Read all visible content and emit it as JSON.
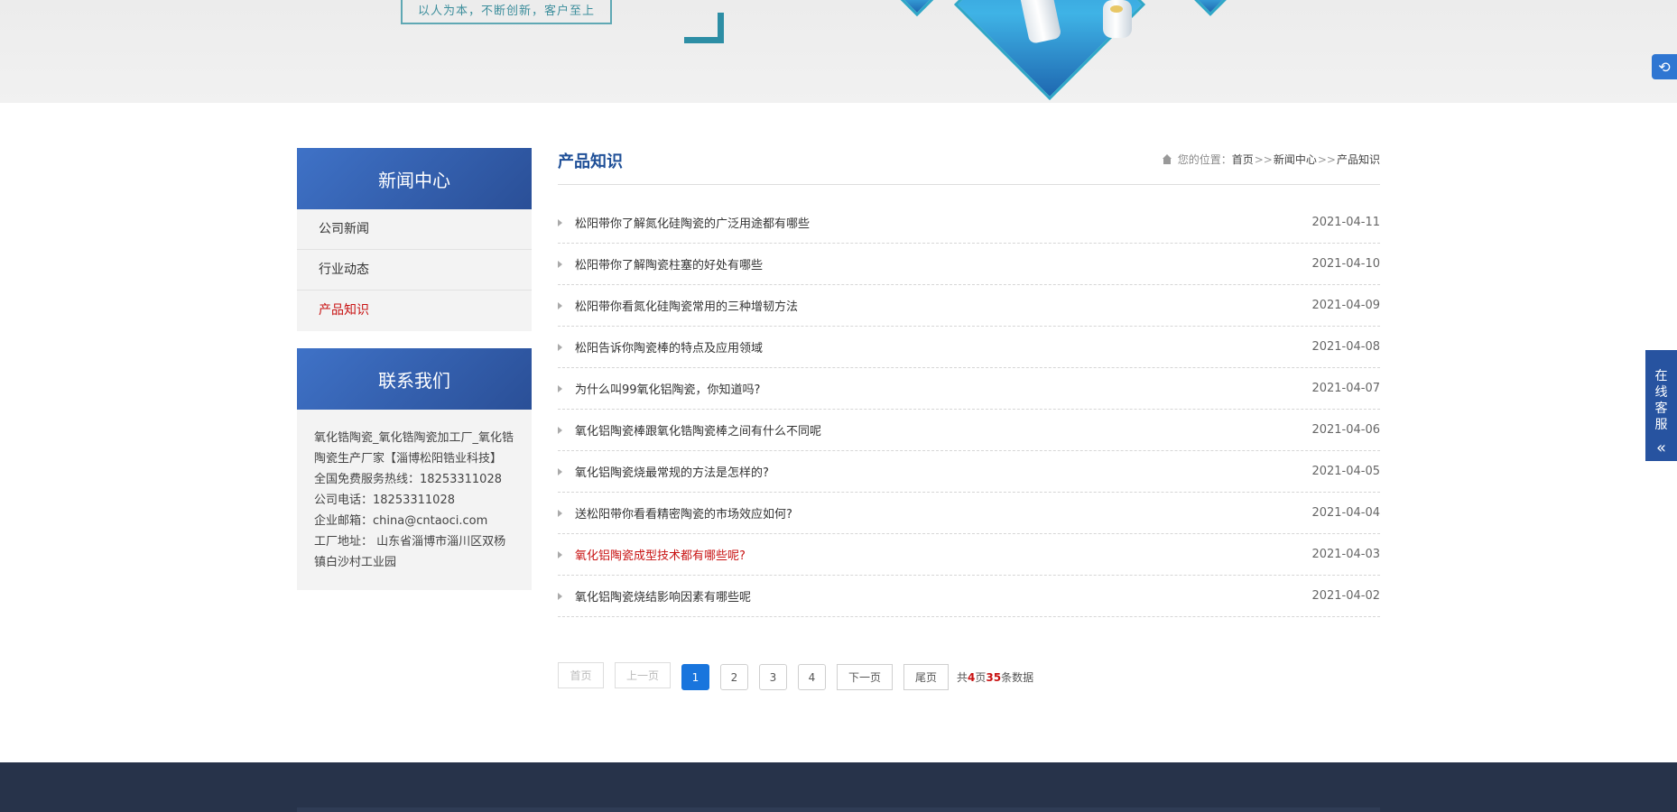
{
  "banner": {
    "slogan": "以人为本，不断创新，客户至上"
  },
  "sidebar": {
    "news_heading": "新闻中心",
    "items": [
      {
        "label": "公司新闻"
      },
      {
        "label": "行业动态"
      },
      {
        "label": "产品知识"
      }
    ],
    "active_index": 2,
    "contact_heading": "联系我们",
    "contact": {
      "company": "氧化锆陶瓷_氧化锆陶瓷加工厂_氧化锆陶瓷生产厂家【淄博松阳锆业科技】",
      "hotline": "全国免费服务热线：18253311028",
      "phone": "公司电话：18253311028",
      "email": "企业邮箱：china@cntaoci.com",
      "address": "工厂地址：  山东省淄博市淄川区双杨镇白沙村工业园"
    }
  },
  "main": {
    "title": "产品知识",
    "breadcrumb": {
      "prefix": "您的位置：",
      "home": "首页",
      "sep": ">>",
      "section": "新闻中心",
      "current": "产品知识"
    },
    "articles": [
      {
        "title": "松阳带你了解氮化硅陶瓷的广泛用途都有哪些",
        "date": "2021-04-11"
      },
      {
        "title": "松阳带你了解陶瓷柱塞的好处有哪些",
        "date": "2021-04-10"
      },
      {
        "title": "松阳带你看氮化硅陶瓷常用的三种增韧方法",
        "date": "2021-04-09"
      },
      {
        "title": "松阳告诉你陶瓷棒的特点及应用领域",
        "date": "2021-04-08"
      },
      {
        "title": "为什么叫99氧化铝陶瓷，你知道吗?",
        "date": "2021-04-07"
      },
      {
        "title": "氧化铝陶瓷棒跟氧化锆陶瓷棒之间有什么不同呢",
        "date": "2021-04-06"
      },
      {
        "title": "氧化铝陶瓷烧最常规的方法是怎样的?",
        "date": "2021-04-05"
      },
      {
        "title": "送松阳带你看看精密陶瓷的市场效应如何?",
        "date": "2021-04-04"
      },
      {
        "title": "氧化铝陶瓷成型技术都有哪些呢?",
        "date": "2021-04-03",
        "highlight": true
      },
      {
        "title": "氧化铝陶瓷烧结影响因素有哪些呢",
        "date": "2021-04-02"
      }
    ],
    "pager": {
      "first": "首页",
      "prev": "上一页",
      "pages": [
        "1",
        "2",
        "3",
        "4"
      ],
      "current": "1",
      "next": "下一页",
      "last": "尾页",
      "info_prefix": "共",
      "total_pages": "4",
      "info_mid": "页",
      "total_items": "35",
      "info_suffix": "条数据"
    }
  },
  "float_service": {
    "chars": [
      "在",
      "线",
      "客",
      "服"
    ],
    "collapse_icon": "«"
  },
  "colors": {
    "brand_blue": "#2a4f97",
    "active_red": "#c81212",
    "page_active": "#1975dd",
    "footer": "#27334a"
  }
}
